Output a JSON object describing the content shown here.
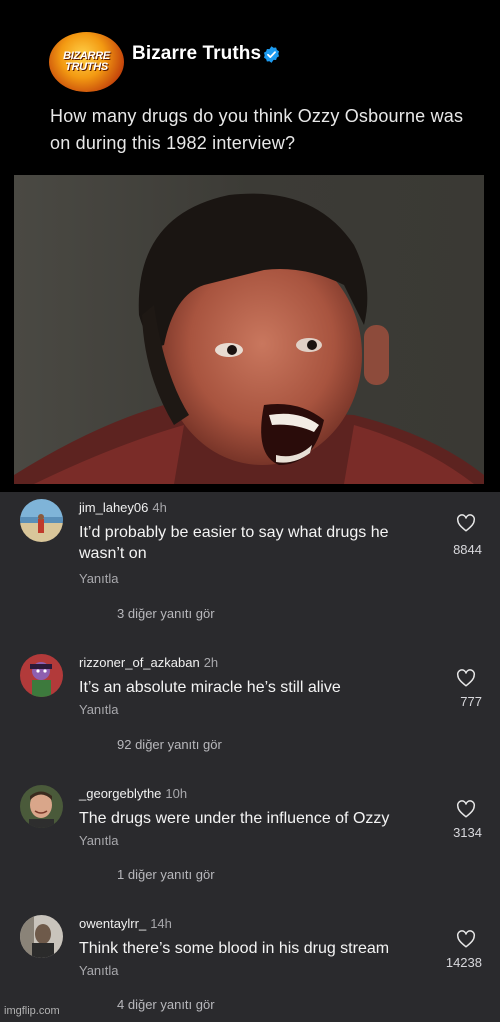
{
  "post": {
    "logo_text_line1": "BIZARRE",
    "logo_text_line2": "TRUTHS",
    "account_name": "Bizarre Truths",
    "verified_icon": "verified-badge-icon",
    "caption": "How many drugs do you think Ozzy Osbourne was on during this 1982 interview?",
    "accent_color": "#1d9bf0"
  },
  "comments": [
    {
      "username": "jim_lahey06",
      "time": "4h",
      "text": "It’d probably be easier to say what drugs he wasn’t on",
      "reply_label": "Yanıtla",
      "view_replies": "3 diğer yanıtı gör",
      "likes": "8844"
    },
    {
      "username": "rizzoner_of_azkaban",
      "time": "2h",
      "text": "It’s an absolute miracle he’s still alive",
      "reply_label": "Yanıtla",
      "view_replies": "92 diğer yanıtı gör",
      "likes": "777"
    },
    {
      "username": "_georgeblythe",
      "time": "10h",
      "text": "The drugs were under the influence of Ozzy",
      "reply_label": "Yanıtla",
      "view_replies": "1 diğer yanıtı gör",
      "likes": "3134"
    },
    {
      "username": "owentaylrr_",
      "time": "14h",
      "text": "Think there’s some blood in his drug stream",
      "reply_label": "Yanıtla",
      "view_replies": "4 diğer yanıtı gör",
      "likes": "14238"
    }
  ],
  "watermark": "imgflip.com"
}
